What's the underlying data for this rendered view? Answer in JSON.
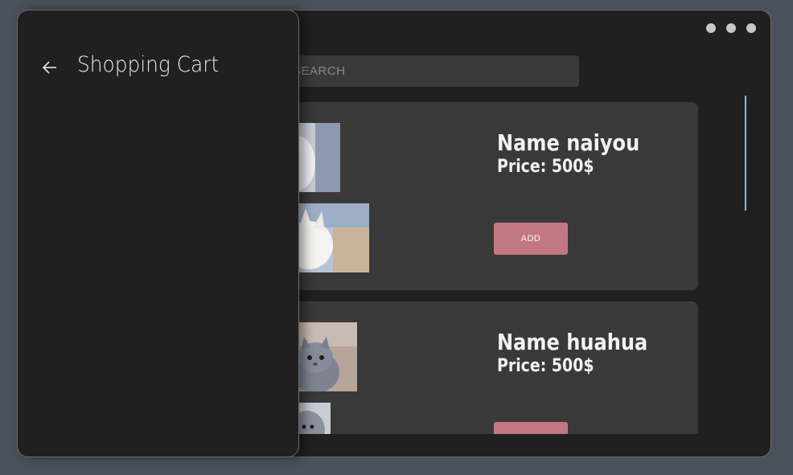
{
  "window": {
    "menu_dots": [
      "dot",
      "dot",
      "dot"
    ]
  },
  "search": {
    "placeholder": "SEARCH"
  },
  "products": [
    {
      "name": "Name naiyou",
      "price": "Price: 500$",
      "add_label": "ADD"
    },
    {
      "name": "Name huahua",
      "price": "Price: 500$",
      "add_label": ""
    }
  ],
  "drawer": {
    "title": "Shopping Cart",
    "back_icon": "arrow-left-icon"
  },
  "colors": {
    "background": "#49525a",
    "window": "#202020",
    "card": "#393939",
    "add_button": "#c27880",
    "accent": "#8fb8d8"
  }
}
